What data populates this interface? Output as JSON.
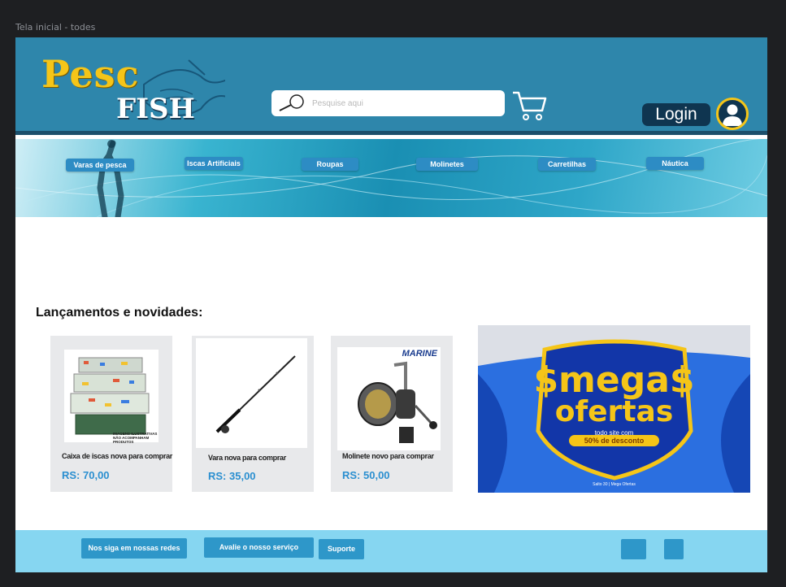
{
  "frame_label": "Tela inicial - todes",
  "header": {
    "logo": {
      "word1": "Pesc",
      "word2": "FISH"
    },
    "search": {
      "placeholder": "Pesquise aqui",
      "value": ""
    },
    "login_label": "Login"
  },
  "nav": [
    {
      "label": "Varas de pesca"
    },
    {
      "label": "Iscas Artificiais"
    },
    {
      "label": "Roupas"
    },
    {
      "label": "Molinetes"
    },
    {
      "label": "Carretilhas"
    },
    {
      "label": "Náutica"
    }
  ],
  "section_title": "Lançamentos e novidades:",
  "products": [
    {
      "name": "Caixa de iscas nova para comprar",
      "price": "RS: 70,00",
      "image_caption": "IMAGENS ILUSTRATIVAS NÃO ACOMPANHAM PRODUTOS"
    },
    {
      "name": "Vara nova para comprar",
      "price": "RS: 35,00"
    },
    {
      "name": "Molinete novo para comprar",
      "price": "RS: 50,00",
      "image_brand": "MARINE"
    }
  ],
  "promo": {
    "line1": "$mega$",
    "line2": "ofertas",
    "sub1": "todo site com",
    "sub2": "50% de desconto",
    "foot": "Salto 30 | Mega Ofertas"
  },
  "footer": {
    "follow_label": "Nos siga em nossas redes",
    "rate_label": "Avalie o nosso serviço",
    "support_label": "Suporte"
  },
  "colors": {
    "header_bg": "#2e86ab",
    "nav_button": "#2d8cc4",
    "price": "#2b8fd0",
    "footer_bg": "#86d6f1",
    "logo_yellow": "#f5c518"
  }
}
